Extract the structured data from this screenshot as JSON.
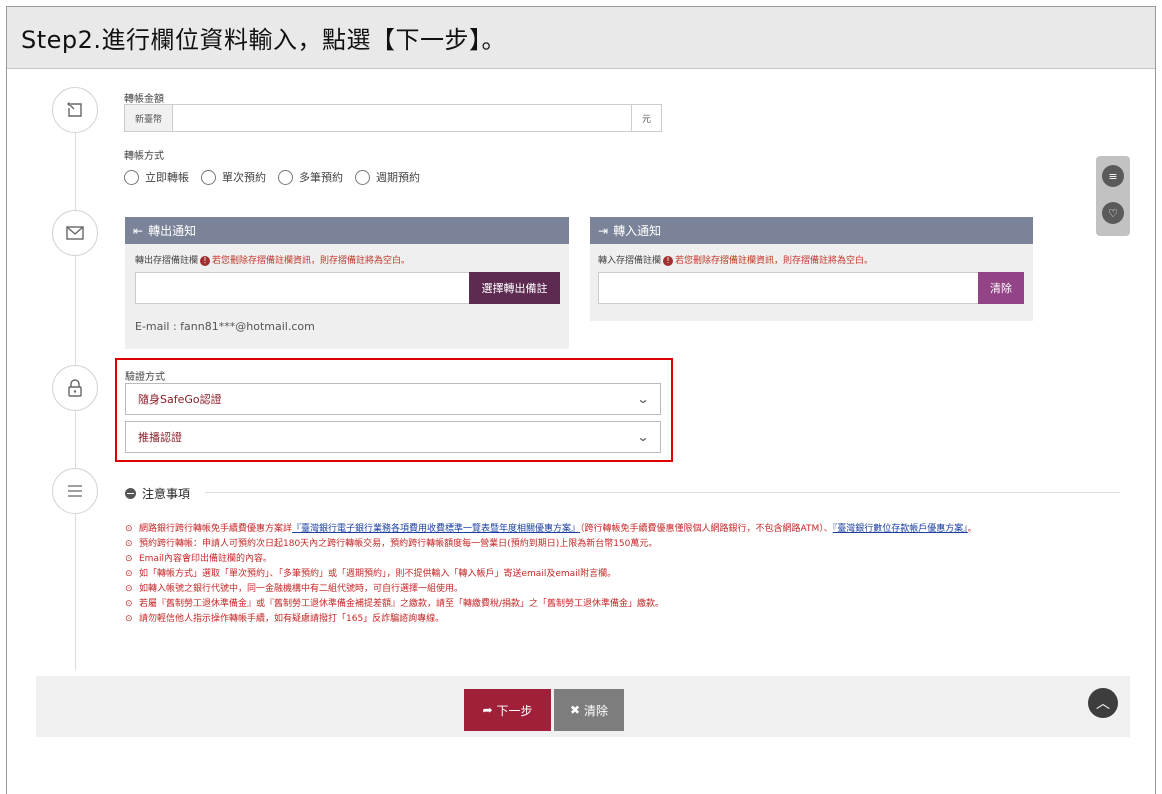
{
  "title": "Step2.進行欄位資料輸入，點選【下一步】。",
  "amount": {
    "label": "轉帳金額",
    "prefix": "新臺幣",
    "suffix": "元",
    "value": ""
  },
  "method": {
    "label": "轉帳方式",
    "options": [
      "立即轉帳",
      "單次預約",
      "多筆預約",
      "週期預約"
    ]
  },
  "out_notice": {
    "title": "轉出通知",
    "hint_label": "轉出存摺備註欄",
    "hint_warning": "若您刪除存摺備註欄資訊，則存摺備註將為空白。",
    "button": "選擇轉出備註",
    "email": "E-mail : fann81***@hotmail.com"
  },
  "in_notice": {
    "title": "轉入通知",
    "hint_label": "轉入存摺備註欄",
    "hint_warning": "若您刪除存摺備註欄資訊，則存摺備註將為空白。",
    "button": "清除"
  },
  "verify": {
    "label": "驗證方式",
    "select1": "隨身SafeGo認證",
    "select2": "推播認證"
  },
  "notes": {
    "title": "注意事項",
    "items": [
      {
        "prefix": "網路銀行跨行轉帳免手續費優惠方案詳",
        "link1": "『臺灣銀行電子銀行業務各項費用收費標準一覽表暨年度相關優惠方案』",
        "middle": "（跨行轉帳免手續費優惠僅限個人網路銀行，不包含網路ATM）、",
        "link2": "『臺灣銀行數位存款帳戶優惠方案』",
        "suffix": "。"
      },
      {
        "text": "預約跨行轉帳：申請人可預約次日起180天內之跨行轉帳交易，預約跨行轉帳額度每一營業日(預約到期日)上限為新台幣150萬元。"
      },
      {
        "text": "Email內容會印出備註欄的內容。"
      },
      {
        "text": "如「轉帳方式」選取「單次預約」、「多筆預約」或「週期預約」，則不提供輸入「轉入帳戶」寄送email及email附言欄。"
      },
      {
        "text": "如轉入帳號之銀行代號中，同一金融機構中有二組代號時，可自行選擇一組使用。"
      },
      {
        "text": "若屬『舊制勞工退休準備金』或『舊制勞工退休準備金補提差額』之繳款，請至「轉繳費稅/捐款」之「舊制勞工退休準備金」繳款。"
      },
      {
        "text": "請勿輕信他人指示操作轉帳手續，如有疑慮請撥打「165」反詐騙諮詢專線。"
      }
    ]
  },
  "footer": {
    "next": "下一步",
    "clear": "清除"
  },
  "colors": {
    "accent": "#a0203a",
    "notice_header": "#7a8397",
    "purple_button": "#5d2a52",
    "highlight_border": "#e00000"
  }
}
